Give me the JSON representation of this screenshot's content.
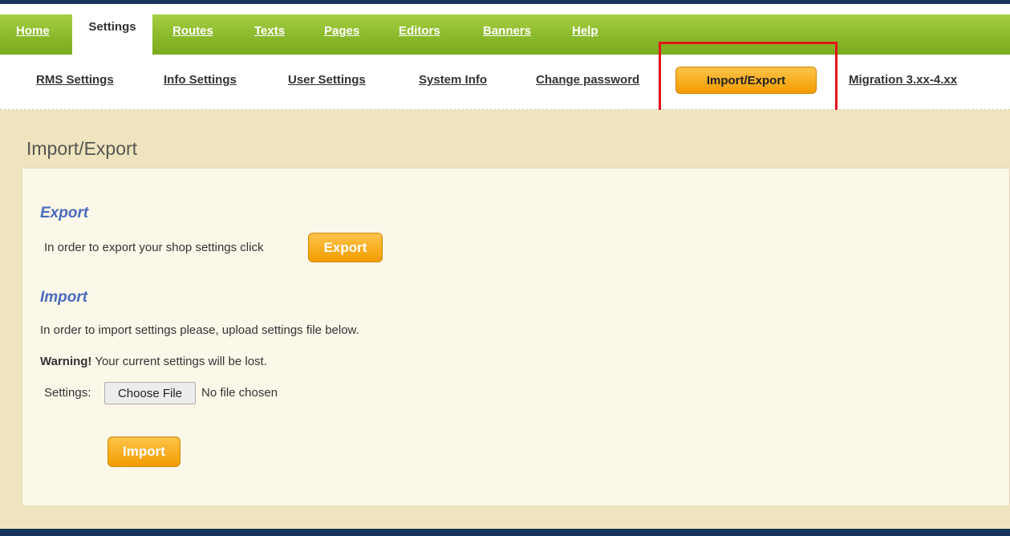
{
  "topnav": {
    "tabs": [
      {
        "label": "Home"
      },
      {
        "label": "Settings"
      },
      {
        "label": "Routes"
      },
      {
        "label": "Texts"
      },
      {
        "label": "Pages"
      },
      {
        "label": "Editors"
      },
      {
        "label": "Banners"
      },
      {
        "label": "Help"
      }
    ],
    "active_tab": "Settings"
  },
  "subnav": {
    "items": [
      {
        "label": "RMS Settings"
      },
      {
        "label": "Info Settings"
      },
      {
        "label": "User Settings"
      },
      {
        "label": "System Info"
      },
      {
        "label": "Change password"
      },
      {
        "label": "Import/Export"
      },
      {
        "label": "Migration 3.xx-4.xx"
      }
    ],
    "active_item": "Import/Export"
  },
  "page": {
    "title": "Import/Export",
    "export": {
      "heading": "Export",
      "text": "In order to export your shop settings click",
      "button": "Export"
    },
    "import": {
      "heading": "Import",
      "text": "In order to import settings please, upload settings file below.",
      "warning_label": "Warning!",
      "warning_text": " Your current settings will be lost.",
      "settings_label": "Settings:",
      "file_button": "Choose File",
      "file_status": "No file chosen",
      "button": "Import"
    }
  },
  "colors": {
    "nav_green": "#8ab92b",
    "navy": "#17345a",
    "orange": "#f29c00",
    "heading_blue": "#4a6bbf",
    "highlight_red": "#e3141a"
  }
}
